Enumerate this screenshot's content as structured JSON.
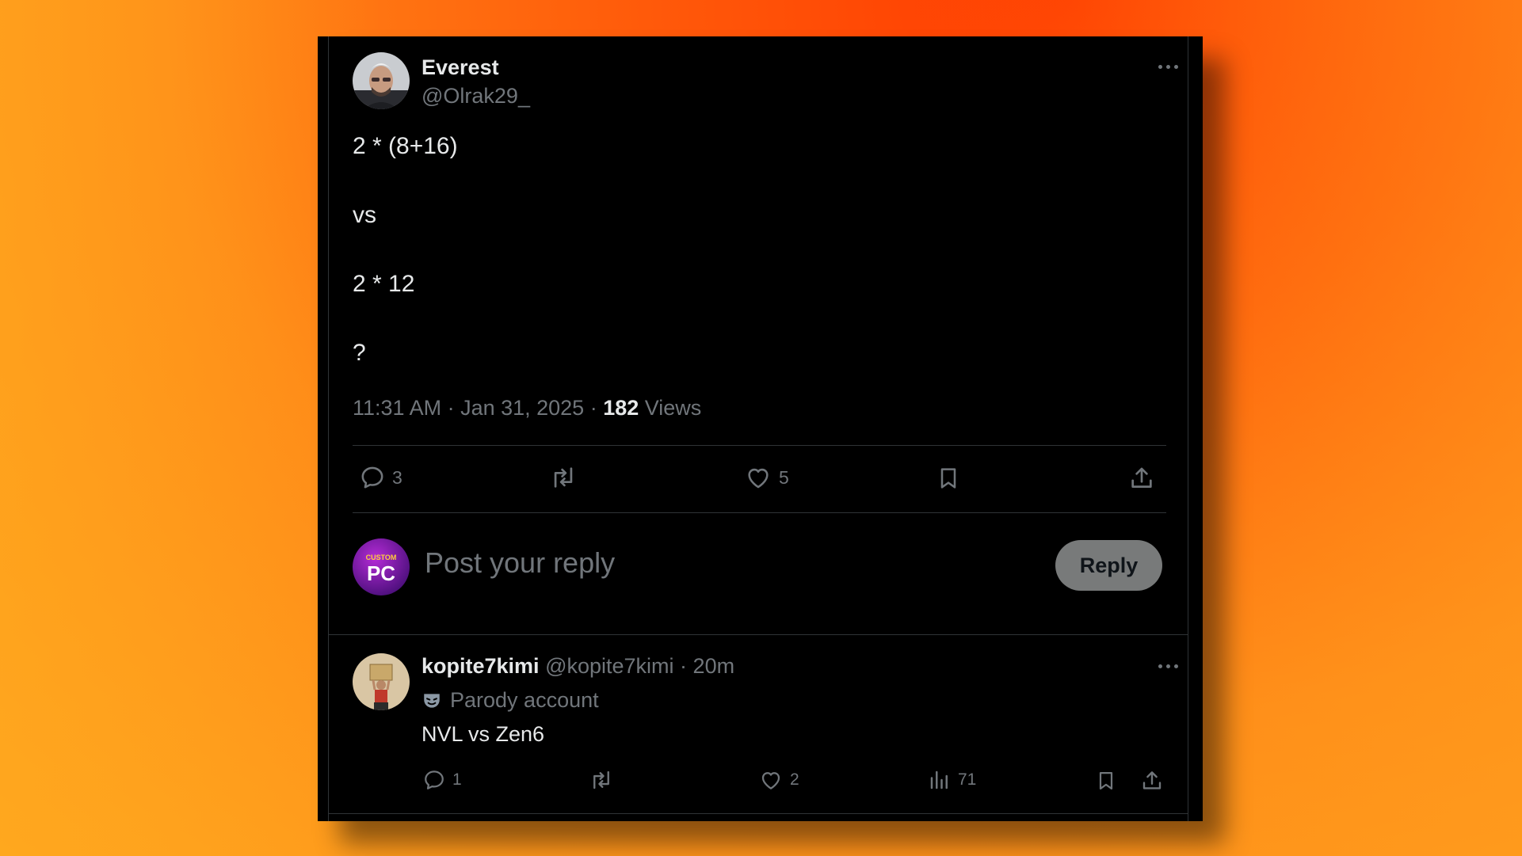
{
  "post": {
    "author_name": "Everest",
    "author_handle": "@Olrak29_",
    "lines": [
      "2 * (8+16)",
      "vs",
      "2 * 12",
      "?"
    ],
    "time": "11:31 AM · Jan 31, 2025 · ",
    "views_count": "182",
    "views_label": " Views",
    "actions": {
      "replies": "3",
      "likes": "5"
    },
    "more_icon": "ellipsis-icon"
  },
  "composer": {
    "avatar_text_top": "CUSTOM",
    "avatar_text_main": "PC",
    "placeholder": "Post your reply",
    "reply_label": "Reply"
  },
  "reply": {
    "name": "kopite7kimi",
    "handle": "@kopite7kimi",
    "separator": " · ",
    "time": "20m",
    "badge": "Parody account",
    "text": "NVL vs Zen6",
    "actions": {
      "replies": "1",
      "likes": "2",
      "views": "71"
    }
  },
  "colors": {
    "background": "#000000",
    "muted": "#71767b",
    "text": "#e7e9ea",
    "divider": "#2f3336",
    "reply_button": "#787a7a"
  }
}
